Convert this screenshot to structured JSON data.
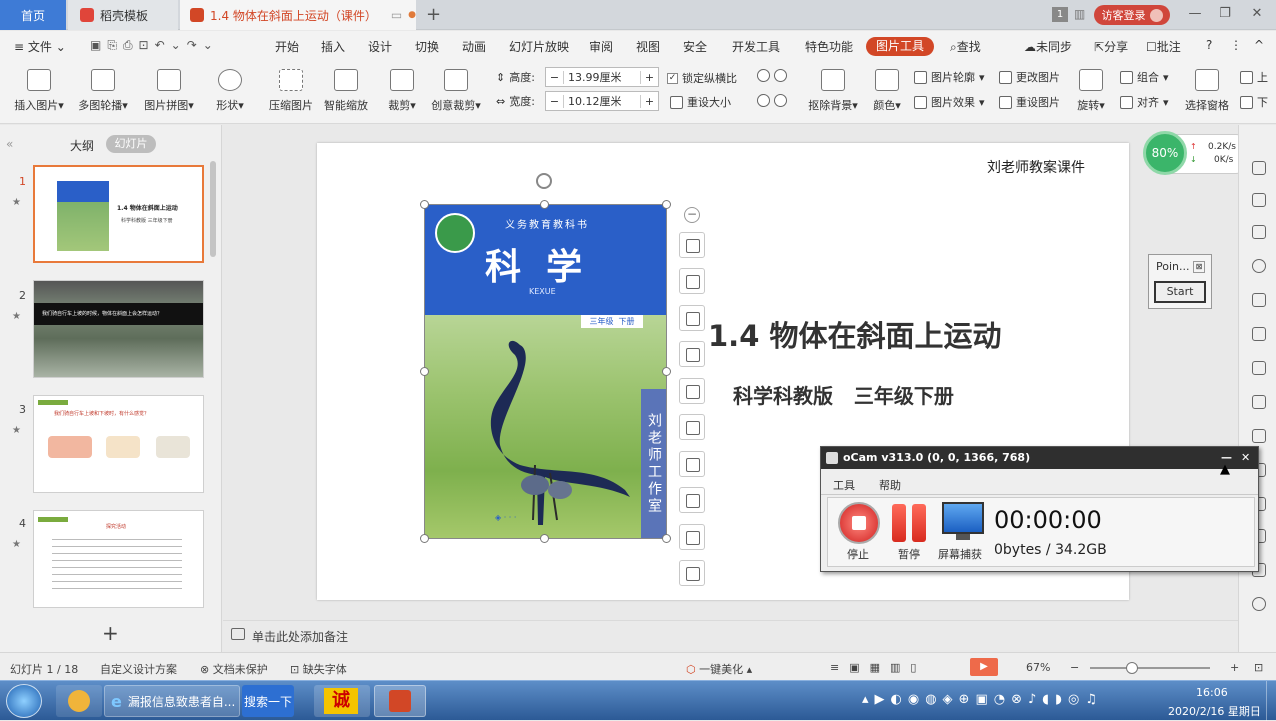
{
  "tabs": {
    "home": "首页",
    "docer": "稻壳模板",
    "active_doc": "1.4 物体在斜面上运动（课件）"
  },
  "titlebar": {
    "badge": "1",
    "login": "访客登录"
  },
  "menu": {
    "file": "文件",
    "items": [
      "开始",
      "插入",
      "设计",
      "切换",
      "动画",
      "幻灯片放映",
      "审阅",
      "视图",
      "安全",
      "开发工具",
      "特色功能"
    ],
    "picture_tools": "图片工具",
    "search": "查找",
    "sync": "未同步",
    "share": "分享",
    "comment": "批注"
  },
  "ribbon": {
    "insert_picture": "插入图片",
    "multi_crop": "多图轮播",
    "collage": "图片拼图",
    "shape": "形状",
    "compress": "压缩图片",
    "smart_scale": "智能缩放",
    "crop": "裁剪",
    "creative_crop": "创意裁剪",
    "height_label": "高度:",
    "height_value": "13.99厘米",
    "width_label": "宽度:",
    "width_value": "10.12厘米",
    "lock_ratio": "锁定纵横比",
    "reset_size": "重设大小",
    "remove_bg": "抠除背景",
    "color": "颜色",
    "outline": "图片轮廓",
    "effect": "图片效果",
    "change_pic": "更改图片",
    "reset_pic": "重设图片",
    "rotate": "旋转",
    "group": "组合",
    "align": "对齐",
    "select_pane": "选择窗格",
    "up": "上",
    "down": "下"
  },
  "leftpanel": {
    "outline_tab": "大纲",
    "slides_tab": "幻灯片",
    "thumbs": [
      {
        "num": "1",
        "title": "1.4 物体在斜面上运动",
        "subtitle": "科学科教版  三年级下册"
      },
      {
        "num": "2",
        "title": "我们骑自行车上坡的时候，物体在斜面上会怎样运动？"
      },
      {
        "num": "3",
        "title": "我们骑自行车上坡和下坡时，有什么感觉？"
      },
      {
        "num": "4",
        "title": "探究活动"
      }
    ],
    "add": "+"
  },
  "slide": {
    "watermark": "刘老师教案课件",
    "title": "1.4 物体在斜面上运动",
    "subtitle": "科学科教版   三年级下册",
    "book": {
      "series": "义务教育教科书",
      "subject": "科  学",
      "pinyin": "KEXUE",
      "grade": "三年级  下册",
      "studio": "刘老师工作室"
    }
  },
  "netmeter": {
    "percent": "80%",
    "up": "0.2K/s",
    "down": "0K/s"
  },
  "pointer_widget": {
    "title": "Poin...",
    "start": "Start"
  },
  "ocam": {
    "title": "oCam v313.0 (0, 0, 1366, 768)",
    "menu_tools": "工具",
    "menu_help": "帮助",
    "stop": "停止",
    "pause": "暂停",
    "screen": "屏幕捕获",
    "timer": "00:00:00",
    "size": "0bytes / 34.2GB"
  },
  "notes": {
    "placeholder": "单击此处添加备注"
  },
  "status": {
    "slide_count": "幻灯片 1 / 18",
    "theme": "自定义设计方案",
    "doc_protect": "文档未保护",
    "missing_font": "缺失字体",
    "beautify": "一键美化",
    "zoom": "67%"
  },
  "taskbar": {
    "ie_title": "漏报信息致患者自...",
    "search_btn": "搜索一下",
    "cheng": "诚",
    "time": "16:06",
    "date": "2020/2/16 星期日"
  },
  "colors": {
    "accent": "#d24726",
    "ribbon_bg": "#f3f3f3",
    "book_blue": "#2a5fc8",
    "taskbar": "#3b6aa8"
  }
}
